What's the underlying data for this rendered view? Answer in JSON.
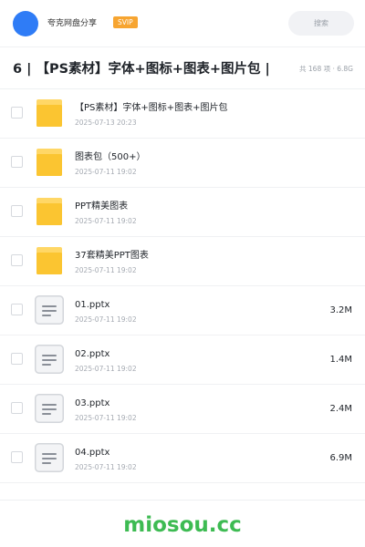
{
  "header": {
    "share_name": "夸克网盘分享",
    "badge": "SVIP",
    "search_placeholder": "搜索"
  },
  "title_bar": {
    "title": "6 | 【PS素材】字体+图标+图表+图片包 |",
    "summary": "共 168 项 · 6.8G"
  },
  "files": [
    {
      "type": "folder",
      "name": "【PS素材】字体+图标+图表+图片包",
      "date": "2025-07-13 20:23",
      "size": ""
    },
    {
      "type": "folder",
      "name": "图表包（500+）",
      "date": "2025-07-11 19:02",
      "size": ""
    },
    {
      "type": "folder",
      "name": "PPT精美图表",
      "date": "2025-07-11 19:02",
      "size": ""
    },
    {
      "type": "folder",
      "name": "37套精美PPT图表",
      "date": "2025-07-11 19:02",
      "size": ""
    },
    {
      "type": "doc",
      "name": "01.pptx",
      "date": "2025-07-11 19:02",
      "size": "3.2M"
    },
    {
      "type": "doc",
      "name": "02.pptx",
      "date": "2025-07-11 19:02",
      "size": "1.4M"
    },
    {
      "type": "doc",
      "name": "03.pptx",
      "date": "2025-07-11 19:02",
      "size": "2.4M"
    },
    {
      "type": "doc",
      "name": "04.pptx",
      "date": "2025-07-11 19:02",
      "size": "6.9M"
    }
  ],
  "footer": {
    "watermark": "miosou.cc"
  },
  "colors": {
    "accent": "#2f7cf6",
    "badge": "#f7a531",
    "folder": "#fbc531",
    "watermark": "#3dbb52"
  }
}
